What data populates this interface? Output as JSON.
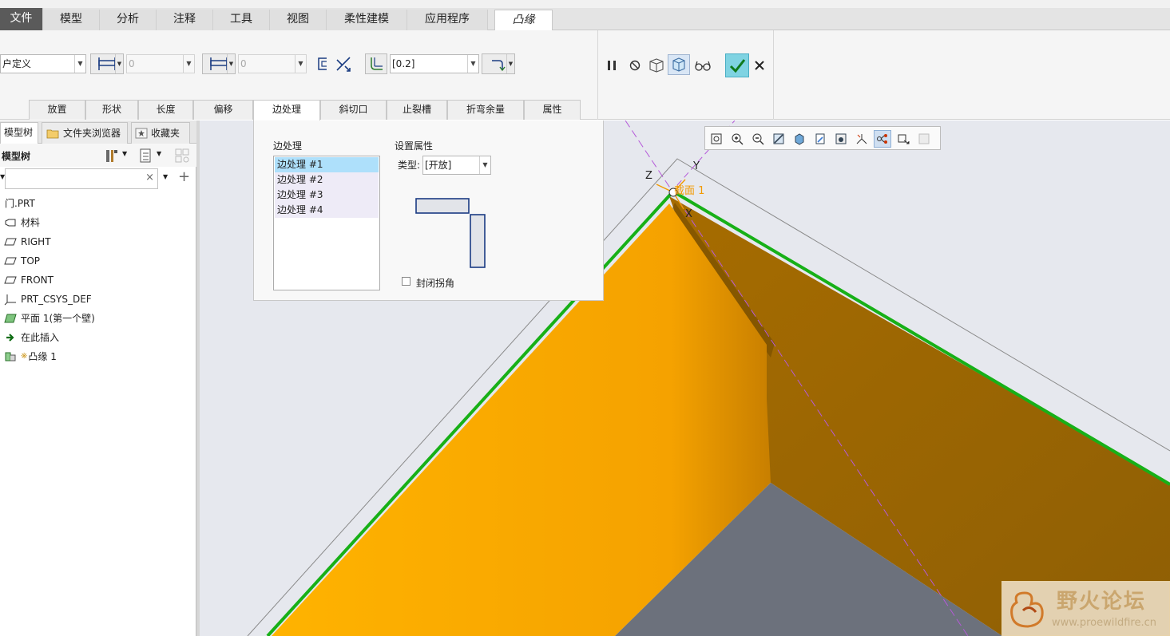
{
  "tabs": [
    {
      "label": "文件"
    },
    {
      "label": "模型"
    },
    {
      "label": "分析"
    },
    {
      "label": "注释"
    },
    {
      "label": "工具"
    },
    {
      "label": "视图"
    },
    {
      "label": "柔性建模"
    },
    {
      "label": "应用程序"
    },
    {
      "label": "凸缘"
    }
  ],
  "ribbon": {
    "shape_combo": "户定义",
    "length1_value": "0",
    "length2_value": "0",
    "radius_value": "[0.2]"
  },
  "subtabs": [
    {
      "label": "放置"
    },
    {
      "label": "形状"
    },
    {
      "label": "长度"
    },
    {
      "label": "偏移"
    },
    {
      "label": "边处理"
    },
    {
      "label": "斜切口"
    },
    {
      "label": "止裂槽"
    },
    {
      "label": "折弯余量"
    },
    {
      "label": "属性"
    }
  ],
  "left_tabs": [
    {
      "label": "模型树"
    },
    {
      "label": "文件夹浏览器"
    },
    {
      "label": "收藏夹"
    }
  ],
  "tree_header": "模型树",
  "tree_items": [
    {
      "label": "门.PRT",
      "icon": "part-icon"
    },
    {
      "label": "材料",
      "icon": "material-icon"
    },
    {
      "label": "RIGHT",
      "icon": "datum-plane-icon"
    },
    {
      "label": "TOP",
      "icon": "datum-plane-icon"
    },
    {
      "label": "FRONT",
      "icon": "datum-plane-icon"
    },
    {
      "label": "PRT_CSYS_DEF",
      "icon": "csys-icon"
    },
    {
      "label": "平面 1(第一个壁)",
      "icon": "planar-wall-icon"
    },
    {
      "label": "在此插入",
      "icon": "insert-arrow-icon"
    },
    {
      "label": "凸缘 1",
      "icon": "flange-icon",
      "prefix": "※"
    }
  ],
  "popup": {
    "list_label": "边处理",
    "items": [
      "边处理 #1",
      "边处理 #2",
      "边处理 #3",
      "边处理 #4"
    ],
    "props_label": "设置属性",
    "type_label": "类型:",
    "type_value": "[开放]",
    "close_corner_label": "封闭拐角"
  },
  "viewport": {
    "axis_z": "Z",
    "axis_y": "Y",
    "axis_x": "X",
    "section_label": "截面 1"
  },
  "watermark": {
    "title": "野火论坛",
    "url": "www.proewildfire.cn"
  },
  "colors": {
    "flange": "#f6a400",
    "edge_green": "#1bab1b",
    "accent_check": "#4fc4d9"
  }
}
